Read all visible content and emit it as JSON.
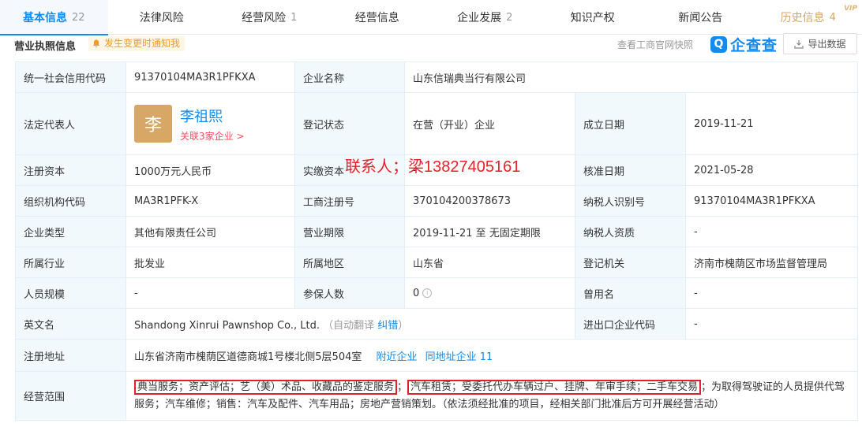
{
  "tabs": [
    {
      "label": "基本信息",
      "count": "22",
      "active": true
    },
    {
      "label": "法律风险",
      "count": ""
    },
    {
      "label": "经营风险",
      "count": "1"
    },
    {
      "label": "经营信息",
      "count": ""
    },
    {
      "label": "企业发展",
      "count": "2"
    },
    {
      "label": "知识产权",
      "count": ""
    },
    {
      "label": "新闻公告",
      "count": ""
    },
    {
      "label": "历史信息",
      "count": "4",
      "vip": "VIP"
    }
  ],
  "section": {
    "title": "营业执照信息",
    "notify": "发生变更时通知我",
    "gs_link": "查看工商官网快照",
    "logo_text": "企查查",
    "export": "导出数据"
  },
  "overlay_text": "联系人；梁13827405161",
  "rows": {
    "credit_code": {
      "label": "统一社会信用代码",
      "value": "91370104MA3R1PFKXA"
    },
    "company_name": {
      "label": "企业名称",
      "value": "山东信瑞典当行有限公司"
    },
    "legal_rep": {
      "label": "法定代表人",
      "avatar": "李",
      "name": "李祖熙",
      "related": "关联3家企业 >"
    },
    "reg_status": {
      "label": "登记状态",
      "value": "在营（开业）企业"
    },
    "found_date": {
      "label": "成立日期",
      "value": "2019-11-21"
    },
    "reg_capital": {
      "label": "注册资本",
      "value": "1000万元人民币"
    },
    "paid_capital": {
      "label": "实缴资本",
      "value": "-"
    },
    "approve_date": {
      "label": "核准日期",
      "value": "2021-05-28"
    },
    "org_code": {
      "label": "组织机构代码",
      "value": "MA3R1PFK-X"
    },
    "reg_no": {
      "label": "工商注册号",
      "value": "370104200378673"
    },
    "taxpayer_id": {
      "label": "纳税人识别号",
      "value": "91370104MA3R1PFKXA"
    },
    "company_type": {
      "label": "企业类型",
      "value": "其他有限责任公司"
    },
    "biz_term": {
      "label": "营业期限",
      "value": "2019-11-21 至 无固定期限"
    },
    "taxpayer_qual": {
      "label": "纳税人资质",
      "value": "-"
    },
    "industry": {
      "label": "所属行业",
      "value": "批发业"
    },
    "region": {
      "label": "所属地区",
      "value": "山东省"
    },
    "reg_authority": {
      "label": "登记机关",
      "value": "济南市槐荫区市场监督管理局"
    },
    "staff_size": {
      "label": "人员规模",
      "value": "-"
    },
    "insured": {
      "label": "参保人数",
      "value": "0"
    },
    "former_name": {
      "label": "曾用名",
      "value": "-"
    },
    "english_name": {
      "label": "英文名",
      "value": "Shandong Xinrui Pawnshop Co., Ltd.",
      "auto_prefix": "（自动翻译",
      "auto_link": "纠错",
      "auto_suffix": "）"
    },
    "ie_code": {
      "label": "进出口企业代码",
      "value": "-"
    },
    "address": {
      "label": "注册地址",
      "value": "山东省济南市槐荫区道德商城1号楼北侧5层504室",
      "nearby": "附近企业",
      "same_addr": "同地址企业 11"
    },
    "scope": {
      "label": "经营范围",
      "part1": "典当服务；资产评估；艺（美）术品、收藏品的鉴定服务",
      "sep1": "；",
      "part2": "汽车租赁；受委托代办车辆过户、挂牌、年审手续；二手车交易",
      "rest": "；为取得驾驶证的人员提供代驾服务；汽车维修；销售：汽车及配件、汽车用品；房地产营销策划。（依法须经批准的项目，经相关部门批准后方可开展经营活动）"
    }
  }
}
